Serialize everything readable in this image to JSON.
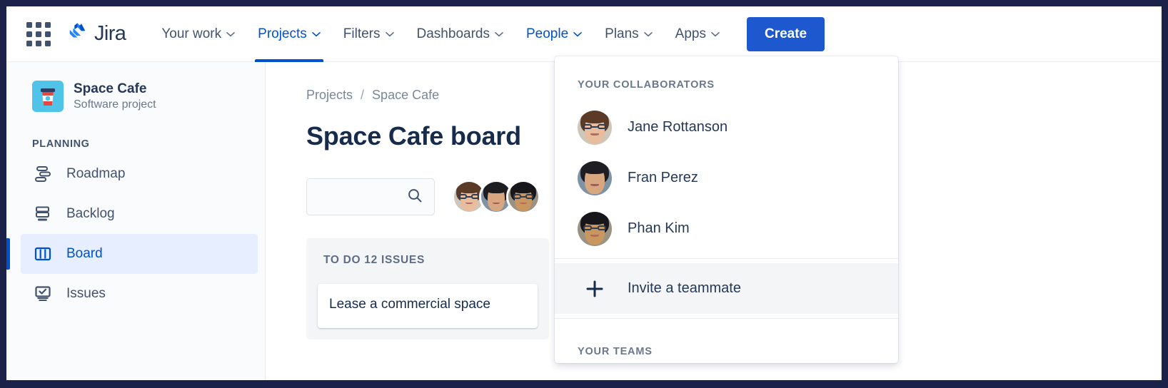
{
  "colors": {
    "brand_blue": "#0052cc",
    "create_button": "#1d58ce",
    "selected_nav_bg": "#e6eeff",
    "text_dark": "#172b4d",
    "text_subtle": "#6b778c",
    "column_bg": "#f4f5f7",
    "project_avatar_bg": "#4fc3e8",
    "frame": "#1b2149"
  },
  "topnav": {
    "app_switcher_icon": "grid-apps-icon",
    "logo_icon": "jira-logo-icon",
    "logo_text": "Jira",
    "items": [
      {
        "label": "Your work",
        "active": false,
        "has_caret": true
      },
      {
        "label": "Projects",
        "active": true,
        "has_caret": true
      },
      {
        "label": "Filters",
        "active": false,
        "has_caret": true
      },
      {
        "label": "Dashboards",
        "active": false,
        "has_caret": true
      },
      {
        "label": "People",
        "active": true,
        "has_caret": true
      },
      {
        "label": "Plans",
        "active": false,
        "has_caret": true
      },
      {
        "label": "Apps",
        "active": false,
        "has_caret": true
      }
    ],
    "create_label": "Create"
  },
  "sidebar": {
    "project": {
      "name": "Space Cafe",
      "subtitle": "Software project",
      "avatar_icon": "coffee-cup-icon"
    },
    "section_label": "PLANNING",
    "items": [
      {
        "label": "Roadmap",
        "icon": "roadmap-icon",
        "selected": false
      },
      {
        "label": "Backlog",
        "icon": "backlog-icon",
        "selected": false
      },
      {
        "label": "Board",
        "icon": "board-columns-icon",
        "selected": true
      },
      {
        "label": "Issues",
        "icon": "issues-screen-icon",
        "selected": false
      }
    ]
  },
  "main": {
    "breadcrumb": [
      {
        "label": "Projects"
      },
      {
        "label": "Space Cafe"
      }
    ],
    "breadcrumb_separator": "/",
    "page_title": "Space Cafe board",
    "search": {
      "value": "",
      "placeholder": "",
      "icon": "search-icon"
    },
    "avatar_stack": [
      {
        "name": "Jane Rottanson"
      },
      {
        "name": "Fran Perez"
      },
      {
        "name": "Phan Kim"
      }
    ],
    "column": {
      "title": "TO DO 12 ISSUES",
      "status": "TO DO",
      "count": 12,
      "count_suffix": "ISSUES",
      "cards": [
        {
          "title": "Lease a commercial space"
        }
      ]
    }
  },
  "people_dropdown": {
    "collaborators_label": "YOUR COLLABORATORS",
    "collaborators": [
      {
        "name": "Jane Rottanson"
      },
      {
        "name": "Fran Perez"
      },
      {
        "name": "Phan Kim"
      }
    ],
    "invite": {
      "label": "Invite a teammate",
      "icon": "plus-icon",
      "highlighted": true
    },
    "teams_label": "YOUR TEAMS"
  }
}
